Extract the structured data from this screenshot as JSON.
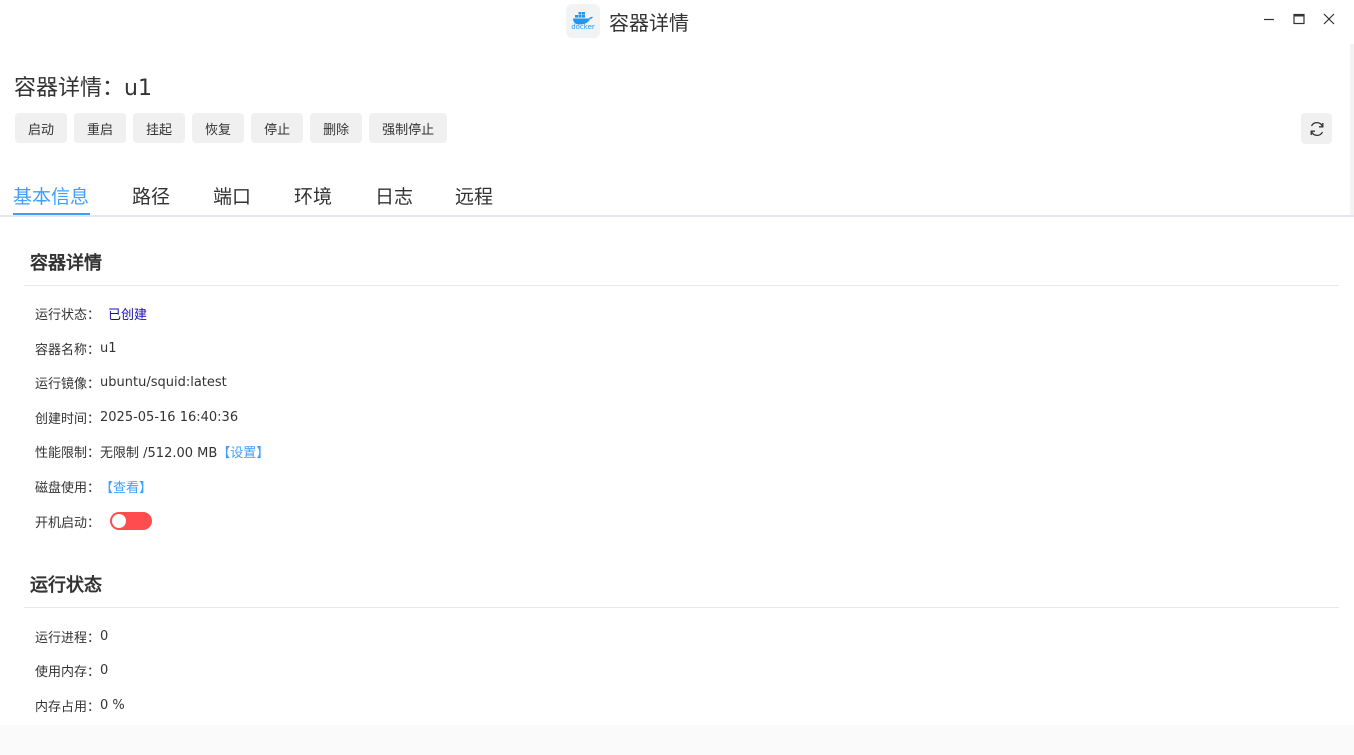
{
  "window": {
    "title": "容器详情",
    "logo_text": "docker"
  },
  "page": {
    "title": "容器详情：u1"
  },
  "toolbar": {
    "buttons": [
      "启动",
      "重启",
      "挂起",
      "恢复",
      "停止",
      "删除",
      "强制停止"
    ]
  },
  "tabs": [
    "基本信息",
    "路径",
    "端口",
    "环境",
    "日志",
    "远程"
  ],
  "active_tab": "基本信息",
  "details": {
    "section_title": "容器详情",
    "status_label": "运行状态：",
    "status_value": "已创建",
    "name_label": "容器名称：",
    "name_value": "u1",
    "image_label": "运行镜像：",
    "image_value": "ubuntu/squid:latest",
    "created_label": "创建时间：",
    "created_value": "2025-05-16 16:40:36",
    "limit_label": "性能限制：",
    "limit_value": "无限制 /512.00 MB",
    "limit_link": "【设置】",
    "disk_label": "磁盘使用：",
    "disk_link": "【查看】",
    "autostart_label": "开机启动：",
    "autostart_enabled": false
  },
  "runtime": {
    "section_title": "运行状态",
    "procs_label": "运行进程：",
    "procs_value": "0",
    "mem_label": "使用内存：",
    "mem_value": "0",
    "mem_pct_label": "内存占用：",
    "mem_pct_value": "0 %"
  },
  "colors": {
    "accent": "#409eff",
    "toggle_off": "#ff4d4f",
    "status_value": "#1a0dab",
    "docker_blue": "#2496ed"
  }
}
